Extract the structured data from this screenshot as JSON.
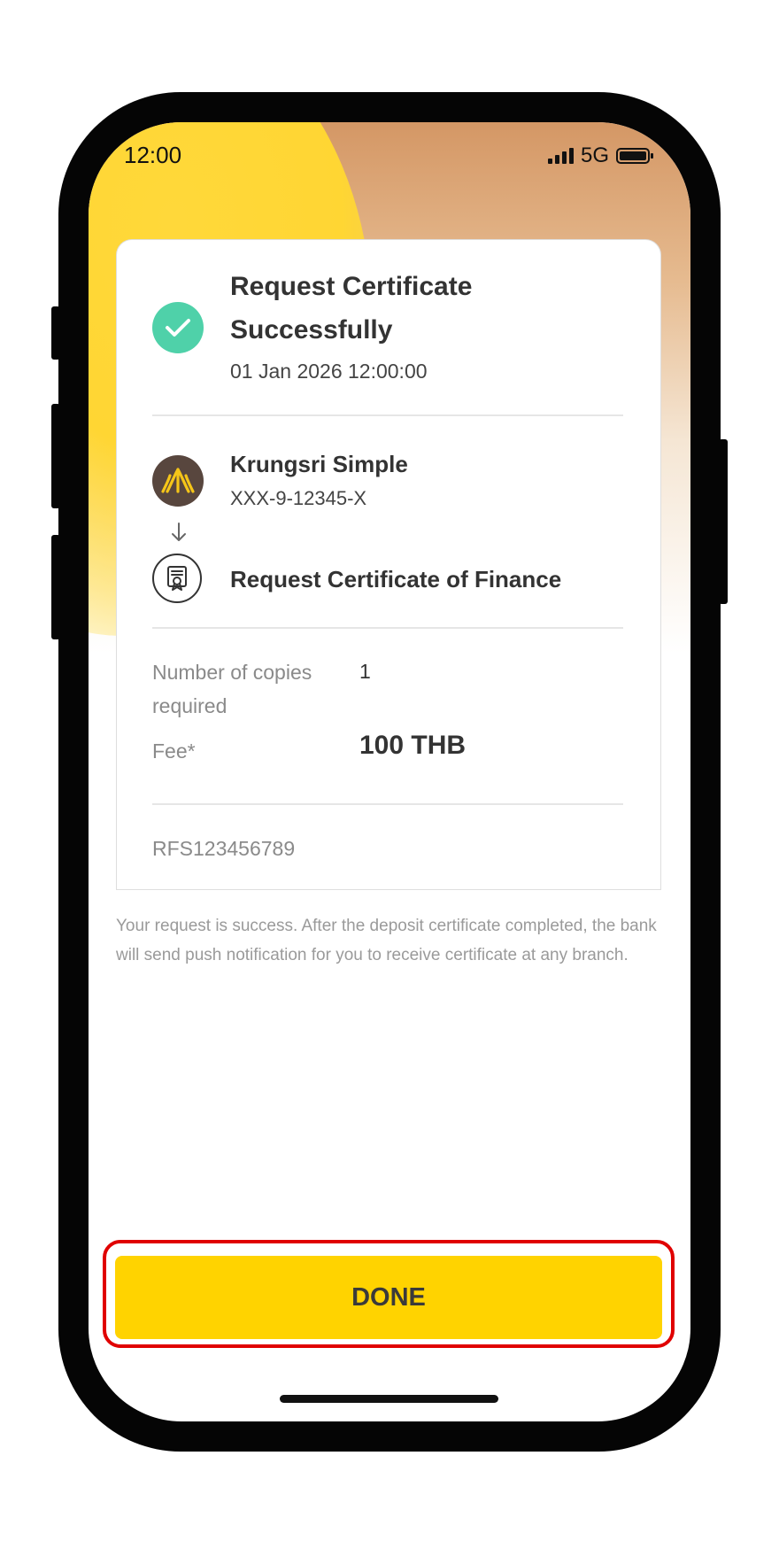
{
  "status_bar": {
    "time": "12:00",
    "network": "5G"
  },
  "result": {
    "title": "Request Certificate Successfully",
    "datetime": "01 Jan 2026 12:00:00"
  },
  "account": {
    "name": "Krungsri Simple",
    "number": "XXX-9-12345-X"
  },
  "service": {
    "name": "Request Certificate of Finance"
  },
  "details": {
    "copies_label": "Number of copies required",
    "copies_value": "1",
    "fee_label": "Fee*",
    "fee_value": "100 THB",
    "reference": "RFS123456789"
  },
  "note": "Your request is success. After the deposit certificate completed, the bank will send push notification for you to receive certificate at any branch.",
  "actions": {
    "done_label": "DONE"
  },
  "colors": {
    "accent": "#FFD300",
    "success": "#4FD1A9",
    "highlight": "#E00000",
    "bank_logo": "#58463E"
  },
  "icons": [
    "signal-icon",
    "battery-icon",
    "check-icon",
    "krungsri-logo",
    "arrow-down-icon",
    "certificate-icon"
  ]
}
